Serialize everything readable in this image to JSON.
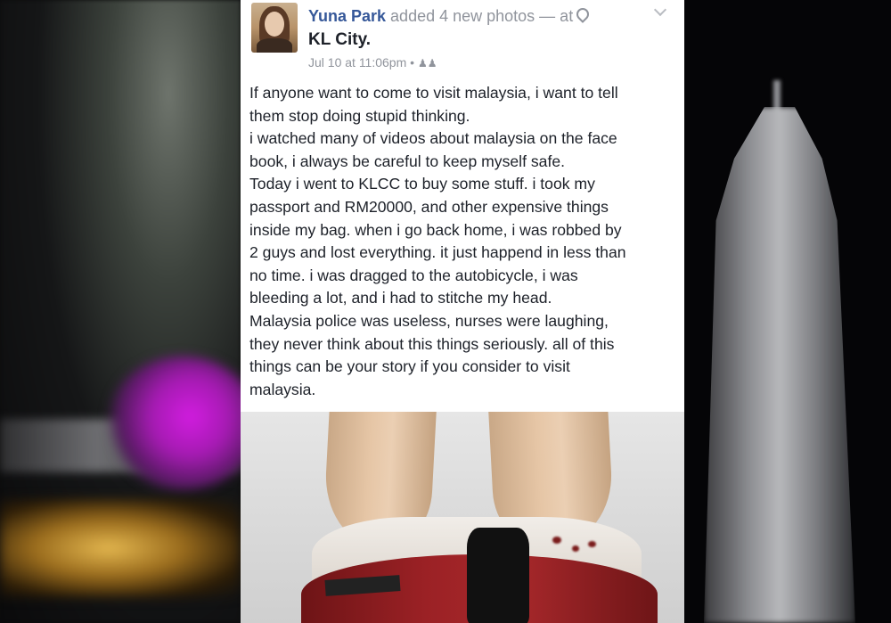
{
  "post": {
    "author": "Yuna Park",
    "action_text": " added 4 new photos — at",
    "location": "KL City.",
    "timestamp": "Jul 10 at 11:06pm",
    "separator": "•",
    "audience_icon": "friends-icon",
    "body_lines": [
      "If anyone want to come to visit malaysia, i want to tell",
      "them stop doing stupid thinking.",
      "i watched many of videos about malaysia on the face",
      "book, i always be careful to keep myself safe.",
      "Today i went to KLCC to buy some stuff. i took my",
      "passport and RM20000, and other expensive things",
      "inside my bag. when i go back home, i was robbed by",
      "2 guys and lost everything. it just happend in less than",
      "no time. i was dragged to the autobicycle, i was",
      "bleeding a lot, and i had to stitche my head.",
      "Malaysia police was useless, nurses were laughing,",
      "they never think about this things seriously. all of this",
      "things can be your story if you consider to visit",
      "malaysia."
    ]
  },
  "colors": {
    "author_link": "#365899",
    "text": "#1d2129",
    "meta": "#90949c"
  }
}
